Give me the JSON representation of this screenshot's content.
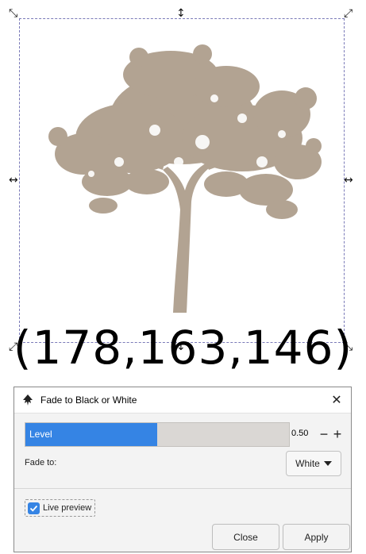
{
  "canvas": {
    "color_readout": "(178,163,146)",
    "tree_color": "#b2a392"
  },
  "dialog": {
    "title": "Fade to Black or White",
    "level": {
      "label": "Level",
      "value": "0.50",
      "fraction": 0.5
    },
    "fade_to": {
      "label": "Fade to:",
      "selected": "White"
    },
    "live_preview": {
      "label": "Live preview",
      "checked": true
    },
    "buttons": {
      "close": "Close",
      "apply": "Apply"
    }
  },
  "colors": {
    "accent": "#3584e4",
    "slider_track": "#dad7d4"
  }
}
